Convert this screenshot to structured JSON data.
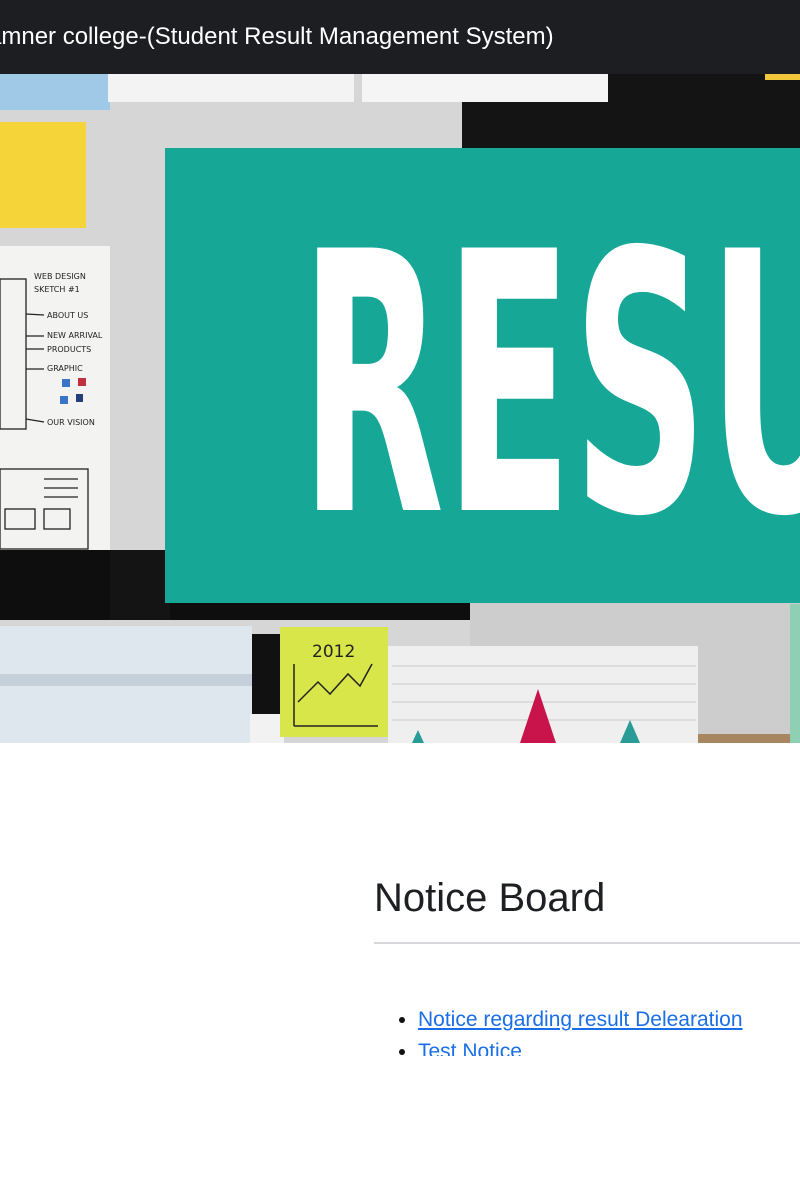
{
  "navbar": {
    "brand": "amner college-(Student Result Management System)"
  },
  "hero": {
    "banner_text": "RESU",
    "sketch_title": "WEB DESIGN",
    "sketch_subtitle": "SKETCH #1",
    "sketch_notes": [
      "ABOUT US",
      "NEW ARRIVAL",
      "PRODUCTS",
      "GRAPHIC",
      "OUR VISION"
    ],
    "sticky_year": "2012",
    "colors": {
      "banner": "#16a797",
      "sticky_yellow": "#f5d43a",
      "sticky_lime": "#d9e64a",
      "triangle_red": "#c8144b",
      "triangle_teal": "#2a9c97"
    }
  },
  "notice_board": {
    "title": "Notice Board",
    "items": [
      {
        "label": "Notice regarding result Delearation"
      },
      {
        "label": "Test Notice"
      }
    ]
  }
}
